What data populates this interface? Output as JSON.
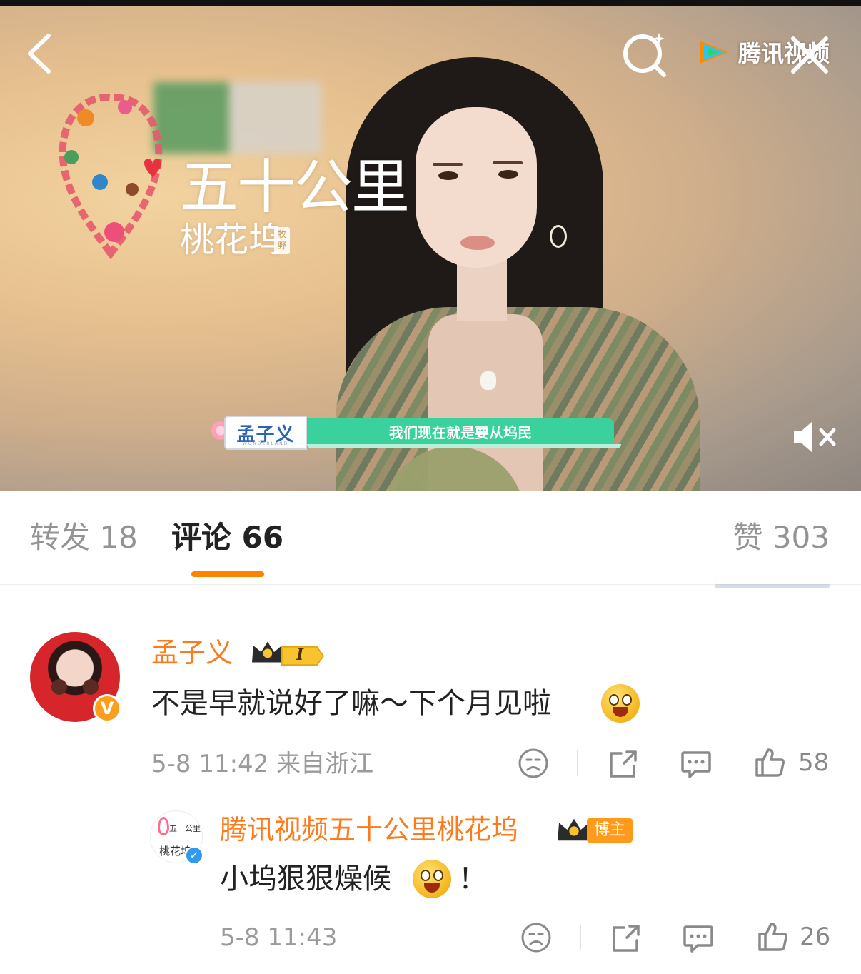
{
  "video": {
    "show_title_line1": "五十公里",
    "show_title_line2": "桃花坞",
    "show_title_tag": "牧野",
    "brand_label": "腾讯视频",
    "banner_name": "孟子义",
    "banner_name_sub": "WONDERLAND",
    "banner_quote": "我们现在就是要从坞民",
    "icons": {
      "back": "back-arrow-icon",
      "search": "search-icon",
      "brand_logo": "tencent-video-logo-icon",
      "close": "close-icon",
      "mute": "muted-speaker-icon"
    }
  },
  "tabs": {
    "repost_label": "转发 18",
    "comment_label": "评论 66",
    "like_label": "赞 303",
    "active": "comment",
    "accent_color": "#ff8200"
  },
  "comments": [
    {
      "name": "孟子义",
      "badge_level": "I",
      "verified": "V",
      "text": "不是早就说好了嘛～下个月见啦",
      "emoji": "laughing-emoji",
      "meta": "5-8 11:42 来自浙江",
      "likes": "58"
    }
  ],
  "reply": {
    "name": "腾讯视频五十公里桃花坞",
    "owner_badge": "博主",
    "text": "小坞狠狠燥候",
    "text_suffix": "！",
    "emoji": "flower-happy-emoji",
    "meta": "5-8 11:43",
    "likes": "26",
    "avatar_line1": "五十公里",
    "avatar_line2": "桃花坞"
  },
  "colors": {
    "name_orange": "#ff7a1a",
    "text": "#222222",
    "muted": "#9a9a9a",
    "banner_green": "#3bd19c",
    "banner_blue": "#2c64b4"
  }
}
